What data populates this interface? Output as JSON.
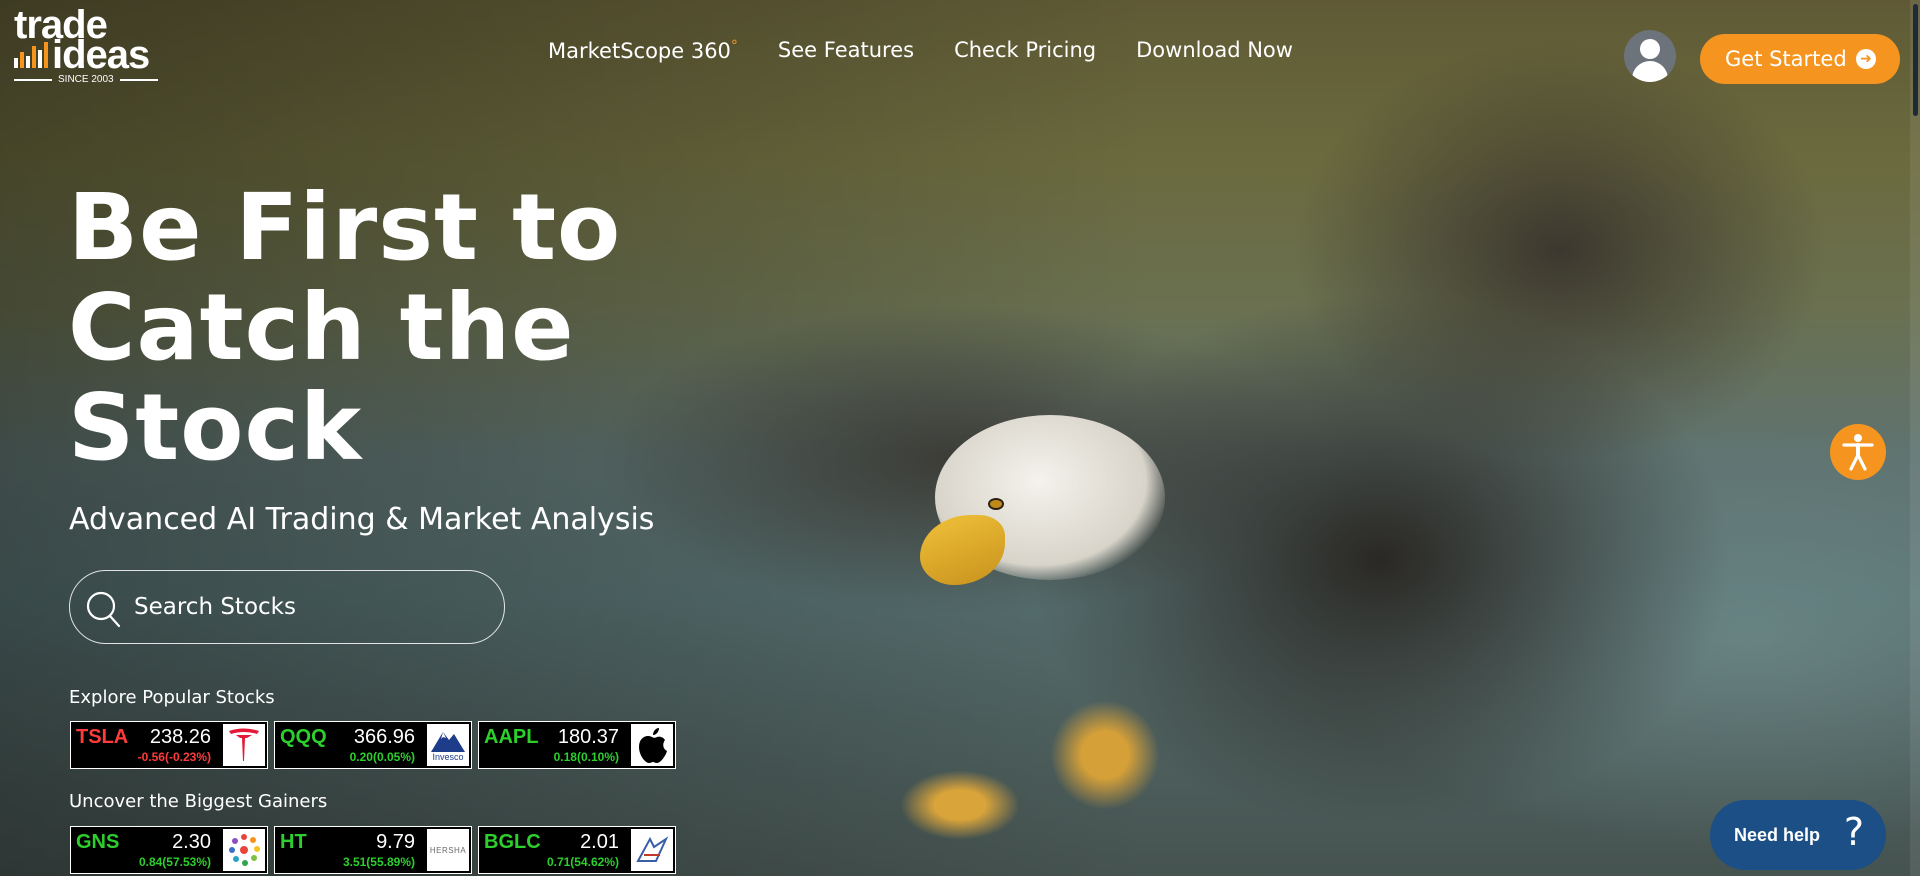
{
  "logo": {
    "line1": "trade",
    "line2": "ideas",
    "since": "SINCE 2003"
  },
  "nav": {
    "items": [
      {
        "label": "MarketScope 360",
        "suffix": "°"
      },
      {
        "label": "See Features"
      },
      {
        "label": "Check Pricing"
      },
      {
        "label": "Download Now"
      }
    ]
  },
  "header": {
    "cta_label": "Get Started"
  },
  "hero": {
    "headline_lines": [
      "Be First to",
      "Catch the",
      "Stock"
    ],
    "subtitle": "Advanced AI Trading & Market Analysis",
    "search_placeholder": "Search Stocks"
  },
  "popular": {
    "label": "Explore Popular Stocks",
    "tickers": [
      {
        "symbol": "TSLA",
        "price": "238.26",
        "change": "-0.56(-0.23%)",
        "direction": "down",
        "logo_icon": "tesla-logo-icon"
      },
      {
        "symbol": "QQQ",
        "price": "366.96",
        "change": "0.20(0.05%)",
        "direction": "up",
        "logo_icon": "invesco-logo-icon",
        "logo_text": "Invesco"
      },
      {
        "symbol": "AAPL",
        "price": "180.37",
        "change": "0.18(0.10%)",
        "direction": "up",
        "logo_icon": "apple-logo-icon"
      }
    ]
  },
  "gainers": {
    "label": "Uncover the Biggest Gainers",
    "tickers": [
      {
        "symbol": "GNS",
        "price": "2.30",
        "change": "0.84(57.53%)",
        "direction": "up",
        "logo_icon": "genius-group-logo-icon"
      },
      {
        "symbol": "HT",
        "price": "9.79",
        "change": "3.51(55.89%)",
        "direction": "up",
        "logo_icon": "hersha-logo-icon",
        "logo_text": "HERSHA"
      },
      {
        "symbol": "BGLC",
        "price": "2.01",
        "change": "0.71(54.62%)",
        "direction": "up",
        "logo_icon": "bglc-logo-icon"
      }
    ]
  },
  "help": {
    "label": "Need help",
    "icon_glyph": "?"
  },
  "colors": {
    "accent": "#f59520",
    "up": "#2ccf2c",
    "down": "#ff3b3b",
    "help_bg": "#1b4f85"
  }
}
